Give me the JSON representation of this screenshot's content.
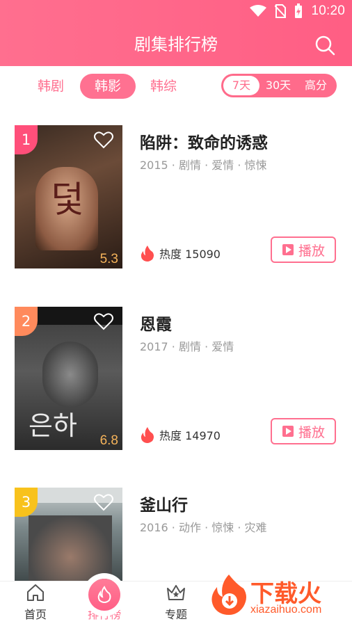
{
  "status": {
    "time": "10:20"
  },
  "header": {
    "title": "剧集排行榜"
  },
  "filters": {
    "categories": [
      {
        "label": "韩剧",
        "active": false
      },
      {
        "label": "韩影",
        "active": true
      },
      {
        "label": "韩综",
        "active": false
      }
    ],
    "periods": [
      {
        "label": "7天",
        "active": true
      },
      {
        "label": "30天",
        "active": false
      },
      {
        "label": "高分",
        "active": false
      }
    ]
  },
  "items": [
    {
      "rank": "1",
      "title": "陷阱：致命的诱惑",
      "meta": "2015 · 剧情 · 爱情 · 惊悚",
      "score": "5.3",
      "heat": "热度 15090",
      "play": "播放",
      "rank_color": "#ff4f7a"
    },
    {
      "rank": "2",
      "title": "恩霞",
      "meta": "2017 · 剧情 · 爱情",
      "score": "6.8",
      "heat": "热度 14970",
      "play": "播放",
      "rank_color": "#ff8a5c"
    },
    {
      "rank": "3",
      "title": "釜山行",
      "meta": "2016 · 动作 · 惊悚 · 灾难",
      "score": "",
      "heat": "",
      "play": "",
      "rank_color": "#f8c21c"
    }
  ],
  "tabbar": {
    "tabs": [
      {
        "label": "首页",
        "icon": "home-icon"
      },
      {
        "label": "排行榜",
        "icon": "flame-icon",
        "active": true
      },
      {
        "label": "专题",
        "icon": "crown-icon"
      }
    ]
  },
  "watermark": {
    "text": "下载火",
    "sub": "xiazaihuo.com"
  }
}
